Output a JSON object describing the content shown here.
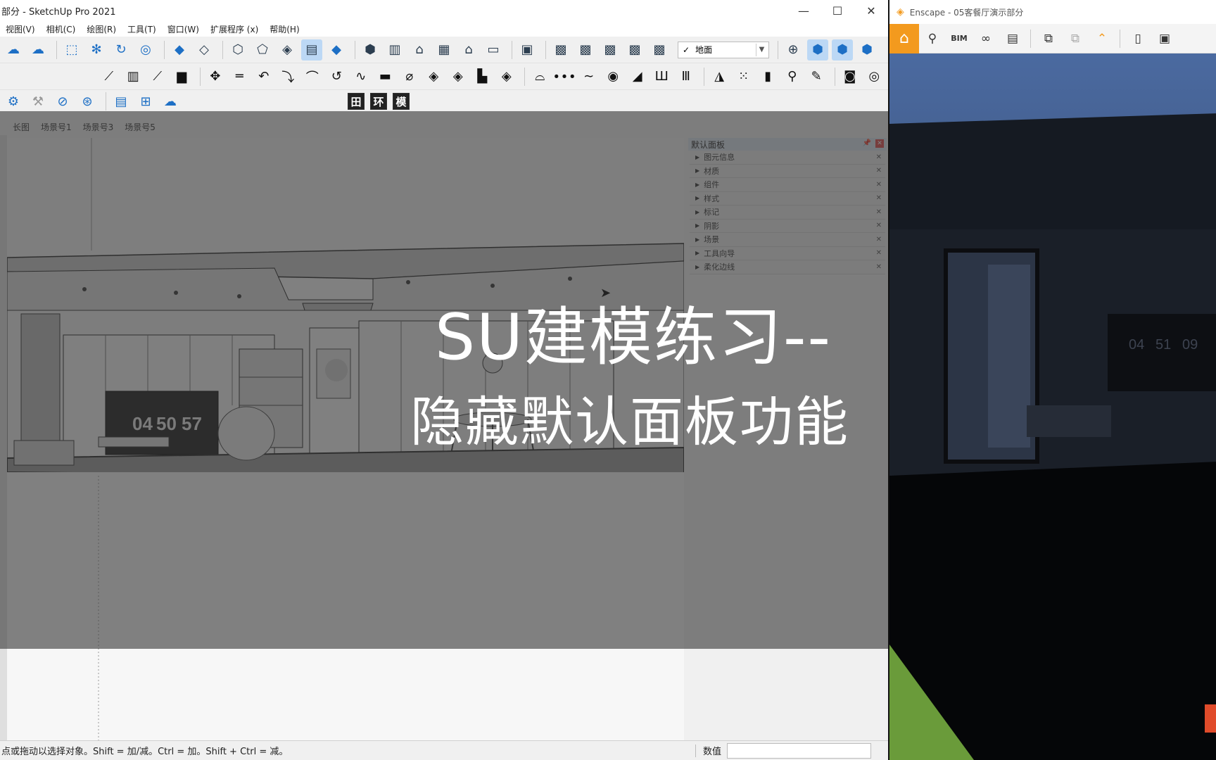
{
  "sketchup": {
    "title": "部分 - SketchUp Pro 2021",
    "window_controls": [
      "—",
      "☐",
      "✕"
    ],
    "menu": [
      "视图(V)",
      "相机(C)",
      "绘图(R)",
      "工具(T)",
      "窗口(W)",
      "扩展程序 (x)",
      "帮助(H)"
    ],
    "layer_value": "地面",
    "layer_check": "✓",
    "mini_toolbar": [
      "田",
      "环",
      "模"
    ],
    "scene_tabs": [
      "长图",
      "场景号1",
      "场景号3",
      "场景号5"
    ],
    "viewport": {
      "clock_digits": [
        "04",
        "50",
        "57"
      ]
    },
    "tray": {
      "title": "默认面板",
      "items": [
        "图元信息",
        "材质",
        "组件",
        "样式",
        "标记",
        "阴影",
        "场景",
        "工具向导",
        "柔化边线"
      ]
    },
    "status": {
      "hint": "点或拖动以选择对象。Shift = 加/减。Ctrl = 加。Shift + Ctrl = 减。",
      "value_label": "数值",
      "value": ""
    }
  },
  "enscape": {
    "title": "Enscape - 05客餐厅演示部分",
    "bim_label": "BIM",
    "clock_digits": [
      "04",
      "51",
      "09"
    ]
  },
  "caption": {
    "line1": "SU建模练习--",
    "line2": "隐藏默认面板功能"
  },
  "colors": {
    "enscape_accent": "#f39a1e",
    "overlay": "#373737",
    "caption_text": "#ffffff"
  }
}
